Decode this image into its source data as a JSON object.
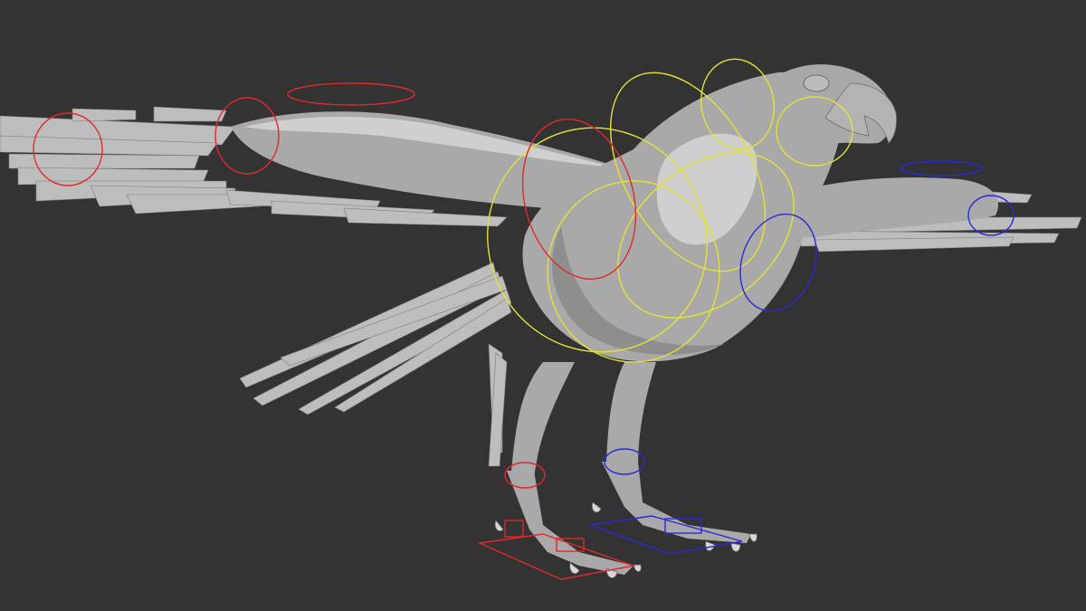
{
  "viewport": {
    "background": "#333333",
    "model_color": "#a9a9a9"
  },
  "rig_controls": {
    "center_color": "#e3e334",
    "left_color": "#e02a2a",
    "right_color": "#2b2bd6"
  }
}
